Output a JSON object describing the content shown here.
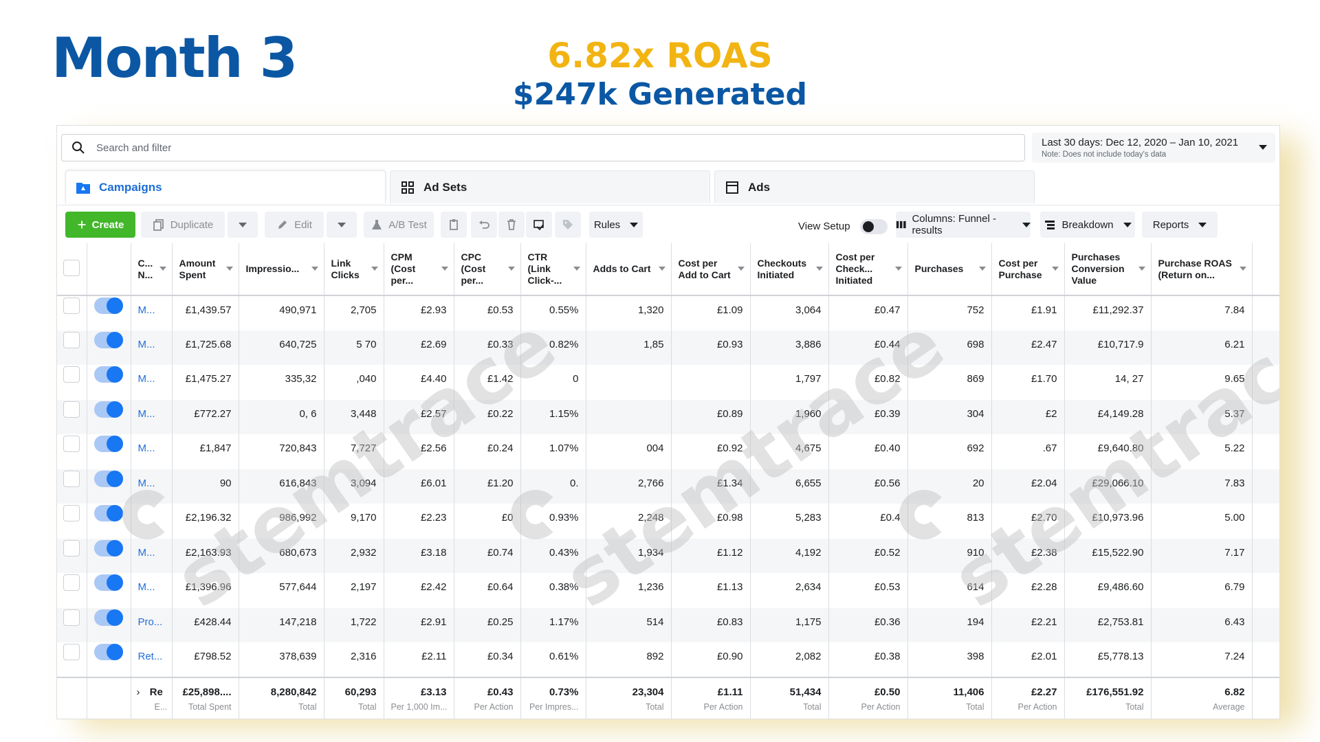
{
  "slide": {
    "title": "Month 3",
    "headline_roas": "6.82x ROAS",
    "headline_generated": "$247k  Generated"
  },
  "search": {
    "placeholder": "Search and filter"
  },
  "date_range": {
    "label": "Last 30 days: Dec 12, 2020 – Jan 10, 2021",
    "note": "Note: Does not include today's data"
  },
  "tabs": [
    {
      "label": "Campaigns",
      "icon": "campaign-folder-icon"
    },
    {
      "label": "Ad Sets",
      "icon": "grid-icon"
    },
    {
      "label": "Ads",
      "icon": "ad-window-icon"
    }
  ],
  "toolbar": {
    "create": "Create",
    "duplicate": "Duplicate",
    "edit": "Edit",
    "ab_test": "A/B Test",
    "rules": "Rules",
    "view_setup": "View Setup",
    "columns": "Columns: Funnel - results",
    "breakdown": "Breakdown",
    "reports": "Reports"
  },
  "table": {
    "headers": [
      "C... N...",
      "Amount Spent",
      "Impressio...",
      "Link Clicks",
      "CPM (Cost per...",
      "CPC (Cost per...",
      "CTR (Link Click-...",
      "Adds to Cart",
      "Cost per Add to Cart",
      "Checkouts Initiated",
      "Cost per Check... Initiated",
      "Purchases",
      "Cost per Purchase",
      "Purchases Conversion Value",
      "Purchase ROAS (Return on..."
    ],
    "rows": [
      [
        "M...",
        "£1,439.57",
        "490,971",
        "2,705",
        "£2.93",
        "£0.53",
        "0.55%",
        "1,320",
        "£1.09",
        "3,064",
        "£0.47",
        "752",
        "£1.91",
        "£11,292.37",
        "7.84"
      ],
      [
        "M...",
        "£1,725.68",
        "640,725",
        "5  70",
        "£2.69",
        "£0.33",
        "0.82%",
        "1,85",
        "£0.93",
        "3,886",
        "£0.44",
        "698",
        "£2.47",
        "£10,717.9",
        "6.21"
      ],
      [
        "M...",
        "£1,475.27",
        "335,32",
        ",040",
        "£4.40",
        "£1.42",
        "0",
        "",
        "",
        "1,797",
        "£0.82",
        "869",
        "£1.70",
        "14,   27",
        "9.65"
      ],
      [
        "M...",
        "£772.27",
        "0,  6",
        "3,448",
        "£2.57",
        "£0.22",
        "1.15%",
        "",
        "£0.89",
        "1,960",
        "£0.39",
        "304",
        "£2  ",
        "£4,149.28",
        "5.37"
      ],
      [
        "M...",
        "£1,847",
        "720,843",
        "7,727",
        "£2.56",
        "£0.24",
        "1.07%",
        "004",
        "£0.92",
        "4,675",
        "£0.40",
        "692",
        ".67",
        "£9,640.80",
        "5.22"
      ],
      [
        "M...",
        "  90",
        "616,843",
        "3,094",
        "£6.01",
        "£1.20",
        "0.",
        "2,766",
        "£1.34",
        "6,655",
        "£0.56",
        " 20",
        "£2.04",
        "£29,066.10",
        "7.83"
      ],
      [
        "",
        "£2,196.32",
        "986,992",
        "9,170",
        "£2.23",
        "£0",
        "0.93%",
        "2,248",
        "£0.98",
        "5,283",
        "£0.4",
        "813",
        "£2.70",
        "£10,973.96",
        "5.00"
      ],
      [
        "M...",
        "£2,163.93",
        "680,673",
        "2,932",
        "£3.18",
        "£0.74",
        "0.43%",
        "1,934",
        "£1.12",
        "4,192",
        "£0.52",
        "910",
        "£2.38",
        "£15,522.90",
        "7.17"
      ],
      [
        "M...",
        "£1,396.96",
        "577,644",
        "2,197",
        "£2.42",
        "£0.64",
        "0.38%",
        "1,236",
        "£1.13",
        "2,634",
        "£0.53",
        "614",
        "£2.28",
        "£9,486.60",
        "6.79"
      ],
      [
        "Pro...",
        "£428.44",
        "147,218",
        "1,722",
        "£2.91",
        "£0.25",
        "1.17%",
        "514",
        "£0.83",
        "1,175",
        "£0.36",
        "194",
        "£2.21",
        "£2,753.81",
        "6.43"
      ],
      [
        "Ret...",
        "£798.52",
        "378,639",
        "2,316",
        "£2.11",
        "£0.34",
        "0.61%",
        "892",
        "£0.90",
        "2,082",
        "£0.38",
        "398",
        "£2.01",
        "£5,778.13",
        "7.24"
      ]
    ],
    "totals": {
      "name": "Re",
      "name_sub": "E...",
      "values": [
        "£25,898....",
        "8,280,842",
        "60,293",
        "£3.13",
        "£0.43",
        "0.73%",
        "23,304",
        "£1.11",
        "51,434",
        "£0.50",
        "11,406",
        "£2.27",
        "£176,551.92",
        "6.82"
      ],
      "subs": [
        "Total Spent",
        "Total",
        "Total",
        "Per 1,000 Im...",
        "Per Action",
        "Per Impres...",
        "Total",
        "Per Action",
        "Total",
        "Per Action",
        "Total",
        "Per Action",
        "Total",
        "Average"
      ]
    }
  },
  "watermark": {
    "text": "stemtrace"
  },
  "colors": {
    "brand_blue": "#0b57a4",
    "gold": "#f2b413",
    "fb_blue": "#1877f2",
    "create_green": "#42b72a"
  }
}
